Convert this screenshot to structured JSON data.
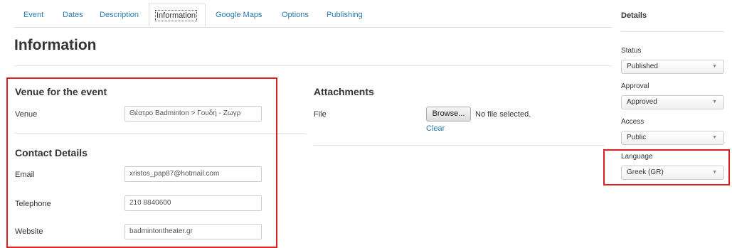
{
  "tabs": [
    {
      "label": "Event"
    },
    {
      "label": "Dates"
    },
    {
      "label": "Description"
    },
    {
      "label": "Information"
    },
    {
      "label": "Google Maps"
    },
    {
      "label": "Options"
    },
    {
      "label": "Publishing"
    }
  ],
  "page": {
    "title": "Information"
  },
  "venue_section": {
    "title": "Venue for the event",
    "venue_label": "Venue",
    "venue_value": "Θέατρο Badminton > Γουδή - Ζωγρ"
  },
  "contact_section": {
    "title": "Contact Details",
    "email_label": "Email",
    "email_value": "xristos_pap87@hotmail.com",
    "telephone_label": "Telephone",
    "telephone_value": "210 8840600",
    "website_label": "Website",
    "website_value": "badmintontheater.gr"
  },
  "attachments": {
    "title": "Attachments",
    "file_label": "File",
    "browse_label": "Browse...",
    "no_file_text": "No file selected.",
    "clear_label": "Clear"
  },
  "details": {
    "title": "Details",
    "status_label": "Status",
    "status_value": "Published",
    "approval_label": "Approval",
    "approval_value": "Approved",
    "access_label": "Access",
    "access_value": "Public",
    "language_label": "Language",
    "language_value": "Greek (GR)",
    "caret": "▼"
  },
  "colors": {
    "link": "#2a7ab0",
    "highlight_border": "#e02020"
  }
}
